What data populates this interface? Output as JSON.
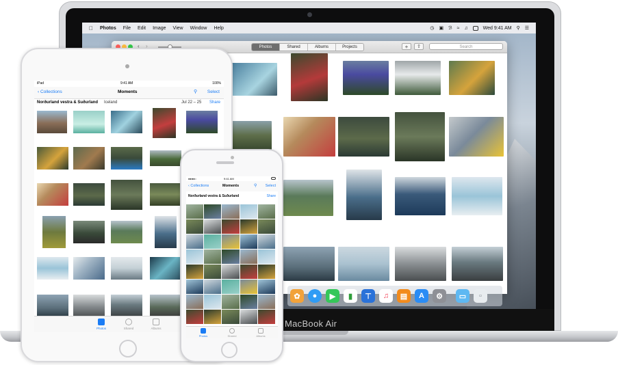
{
  "mac": {
    "brand_label": "MacBook Air",
    "menubar": {
      "apple_icon": "apple-logo-icon",
      "app_name": "Photos",
      "items": [
        "File",
        "Edit",
        "Image",
        "View",
        "Window",
        "Help"
      ],
      "clock": "Wed 9:41 AM"
    },
    "toolbar": {
      "tabs": [
        "Photos",
        "Shared",
        "Albums",
        "Projects"
      ],
      "active_tab": "Photos",
      "add_label": "+",
      "share_icon": "share-icon",
      "search_placeholder": "Search"
    },
    "dock_icons": [
      "photos-icon",
      "messages-icon",
      "facetime-icon",
      "numbers-icon",
      "keynote-icon",
      "music-icon",
      "ibooks-icon",
      "app-store-icon",
      "system-preferences-icon",
      "folder-icon",
      "trash-icon"
    ]
  },
  "ipad": {
    "status": {
      "left": "iPad",
      "time": "9:41 AM",
      "right": "100%"
    },
    "nav": {
      "back_label": "Collections",
      "title": "Moments",
      "select_label": "Select"
    },
    "location": {
      "place": "Norðurland vestra & Suðurland",
      "country": "Iceland",
      "date": "Jul 22 – 25",
      "share_label": "Share"
    },
    "tabs": [
      "Photos",
      "Shared",
      "Albums"
    ],
    "active_tab": "Photos"
  },
  "iphone": {
    "status": {
      "time": "9:41 AM"
    },
    "nav": {
      "back_label": "Collections",
      "title": "Moments",
      "select_label": "Select"
    },
    "location": {
      "place": "Norðurland vestra & Suðurland",
      "share_label": "Share"
    },
    "tabs": [
      "Photos",
      "Shared",
      "Albums"
    ],
    "active_tab": "Photos"
  }
}
